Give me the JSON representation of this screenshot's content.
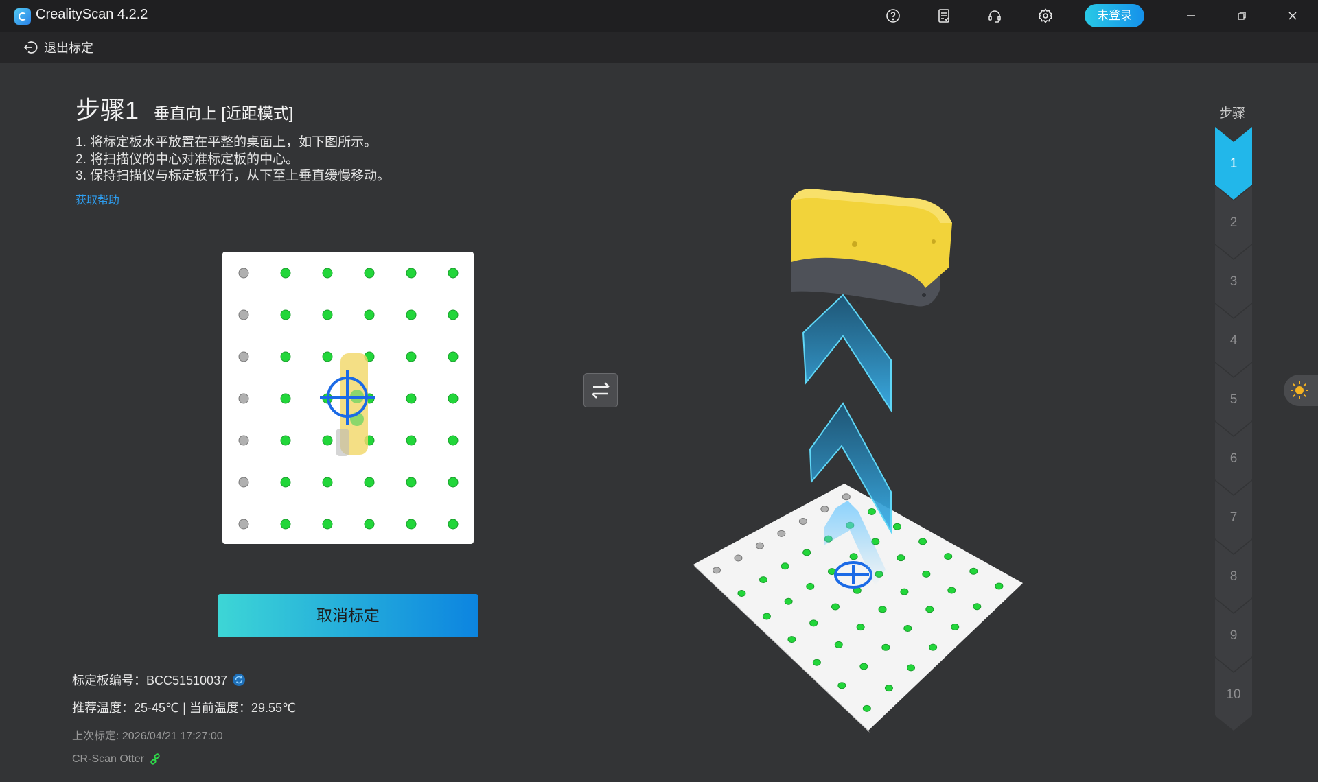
{
  "app": {
    "title": "CrealityScan 4.2.2",
    "login_label": "未登录"
  },
  "toolbar": {
    "exit_label": "退出标定"
  },
  "step": {
    "number": "步骤1",
    "subtitle": "垂直向上 [近距模式]",
    "instructions": [
      "1. 将标定板水平放置在平整的桌面上，如下图所示。",
      "2. 将扫描仪的中心对准标定板的中心。",
      "3. 保持扫描仪与标定板平行，从下至上垂直缓慢移动。"
    ],
    "help_link": "获取帮助"
  },
  "actions": {
    "cancel_label": "取消标定"
  },
  "info": {
    "board_id": "标定板编号：BCC51510037",
    "temperature": "推荐温度：25-45℃ | 当前温度：29.55℃",
    "last_calibration": "上次标定: 2026/04/21 17:27:00",
    "device": "CR-Scan Otter"
  },
  "steps_panel": {
    "title": "步骤",
    "items": [
      "1",
      "2",
      "3",
      "4",
      "5",
      "6",
      "7",
      "8",
      "9",
      "10"
    ],
    "active_index": 0
  },
  "colors": {
    "accent": "#1591ea",
    "dot_green": "#22d63a",
    "dot_gray": "#b0b0b0",
    "scanner_yellow": "#f2d33a"
  },
  "icons": [
    "help-icon",
    "notes-icon",
    "headset-icon",
    "settings-icon",
    "minimize-icon",
    "restore-icon",
    "close-icon",
    "back-arrow-icon",
    "swap-icon",
    "refresh-icon",
    "link-icon",
    "sun-icon"
  ]
}
